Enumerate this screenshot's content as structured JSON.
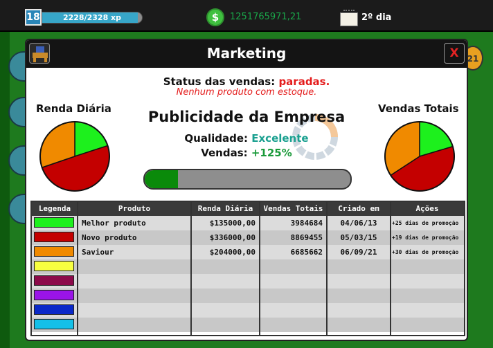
{
  "topbar": {
    "level": "18",
    "xp_text": "2228/2328 xp",
    "xp_fraction": 0.957,
    "money_icon": "$",
    "money": "1251765971,21",
    "day": "2º dia"
  },
  "side_badge": "21",
  "modal": {
    "title": "Marketing",
    "close_label": "X",
    "status_label": "Status das vendas: ",
    "status_value": "paradas.",
    "status_note": "Nenhum produto com estoque.",
    "left_pie_title": "Renda Diária",
    "right_pie_title": "Vendas Totais",
    "pub_title": "Publicidade da Empresa",
    "quality_label": "Qualidade: ",
    "quality_value": "Excelente",
    "sales_label": "Vendas: ",
    "sales_value": "+125%",
    "progress_fraction": 0.16
  },
  "table": {
    "headers": {
      "legend": "Legenda",
      "product": "Produto",
      "daily": "Renda Diária",
      "total": "Vendas Totais",
      "created": "Criado em",
      "actions": "Ações"
    },
    "rows": [
      {
        "color": "#1df01d",
        "product": "Melhor produto",
        "daily": "$135000,00",
        "total": "3984684",
        "created": "04/06/13",
        "action": "+25 dias de promoção"
      },
      {
        "color": "#c40000",
        "product": "Novo produto",
        "daily": "$336000,00",
        "total": "8869455",
        "created": "05/03/15",
        "action": "+19 dias de promoção"
      },
      {
        "color": "#f08a00",
        "product": "Saviour",
        "daily": "$204000,00",
        "total": "6685662",
        "created": "06/09/21",
        "action": "+30 dias de promoção"
      },
      {
        "color": "#f7ff40"
      },
      {
        "color": "#8c0a4a"
      },
      {
        "color": "#9a14e8"
      },
      {
        "color": "#0a28c8"
      },
      {
        "color": "#14c0e8"
      }
    ]
  },
  "colors": {
    "green": "#1df01d",
    "red": "#c40000",
    "orange": "#f08a00"
  },
  "chart_data": [
    {
      "type": "pie",
      "title": "Renda Diária",
      "categories": [
        "Melhor produto",
        "Novo produto",
        "Saviour"
      ],
      "values": [
        135000,
        336000,
        204000
      ]
    },
    {
      "type": "pie",
      "title": "Vendas Totais",
      "categories": [
        "Melhor produto",
        "Novo produto",
        "Saviour"
      ],
      "values": [
        3984684,
        8869455,
        6685662
      ]
    }
  ]
}
